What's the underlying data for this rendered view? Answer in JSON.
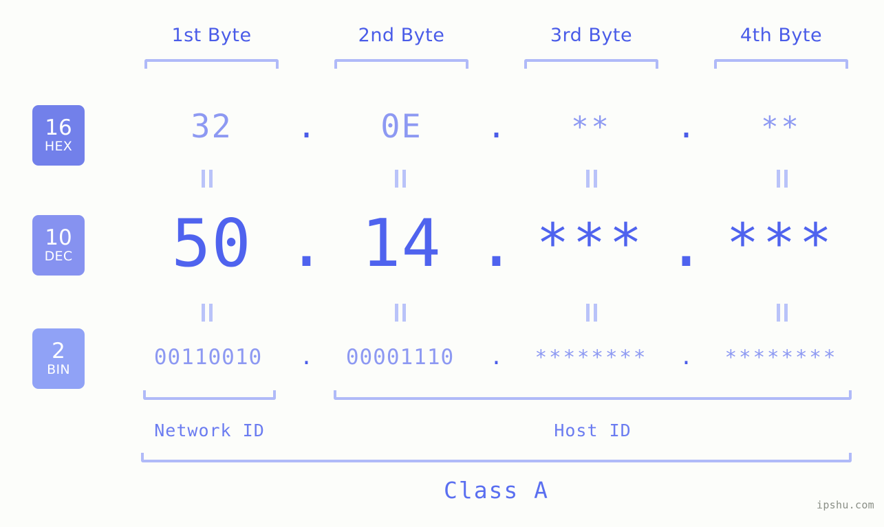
{
  "background_color": "#fcfdfa",
  "accent_colors": {
    "strong_blue": "#4f63ee",
    "mid_blue": "#6b7cf0",
    "light_blue": "#8d99f2",
    "bracket": "#b0baf8",
    "badge_hex": "#7280ea",
    "badge_dec": "#8692f0",
    "badge_bin": "#90a2f6",
    "watermark": "#8a8f86"
  },
  "byte_headers": [
    {
      "label": "1st Byte"
    },
    {
      "label": "2nd Byte"
    },
    {
      "label": "3rd Byte"
    },
    {
      "label": "4th Byte"
    }
  ],
  "bases": [
    {
      "number": "16",
      "name": "HEX"
    },
    {
      "number": "10",
      "name": "DEC"
    },
    {
      "number": "2",
      "name": "BIN"
    }
  ],
  "rows": {
    "hex": {
      "base_number": "16",
      "base_name": "HEX",
      "values": [
        "32",
        "0E",
        "**",
        "**"
      ],
      "separators": [
        ".",
        ".",
        "."
      ]
    },
    "dec": {
      "base_number": "10",
      "base_name": "DEC",
      "values": [
        "50",
        "14",
        "***",
        "***"
      ],
      "separators": [
        ".",
        ".",
        "."
      ]
    },
    "bin": {
      "base_number": "2",
      "base_name": "BIN",
      "values": [
        "00110010",
        "00001110",
        "********",
        "********"
      ],
      "separators": [
        ".",
        ".",
        "."
      ]
    }
  },
  "equals_marker": "=",
  "id_sections": [
    {
      "label": "Network ID"
    },
    {
      "label": "Host ID"
    }
  ],
  "class_label": "Class A",
  "watermark": "ipshu.com"
}
